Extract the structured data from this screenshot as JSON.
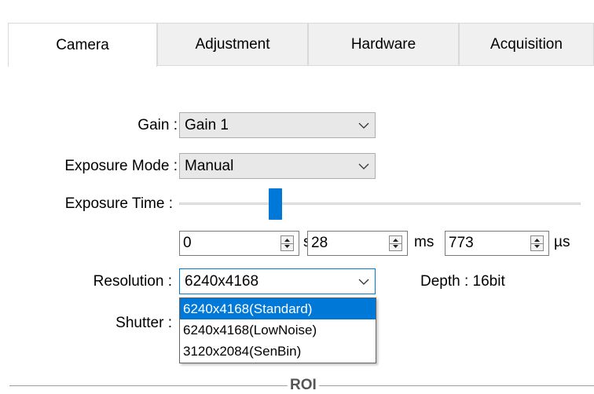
{
  "tabs": [
    {
      "label": "Camera",
      "active": true
    },
    {
      "label": "Adjustment",
      "active": false
    },
    {
      "label": "Hardware",
      "active": false
    },
    {
      "label": "Acquisition",
      "active": false
    }
  ],
  "gain": {
    "label": "Gain :",
    "value": "Gain 1"
  },
  "exposure_mode": {
    "label": "Exposure Mode :",
    "value": "Manual"
  },
  "exposure_time": {
    "label": "Exposure Time :",
    "slider_position": 0.23
  },
  "time_fields": [
    {
      "value": "0",
      "unit": "s"
    },
    {
      "value": "28",
      "unit": "ms"
    },
    {
      "value": "773",
      "unit": "µs"
    }
  ],
  "resolution": {
    "label": "Resolution :",
    "value": "6240x4168"
  },
  "depth": {
    "text": "Depth : 16bit"
  },
  "shutter": {
    "label": "Shutter :"
  },
  "resolution_options": [
    "6240x4168(Standard)",
    "6240x4168(LowNoise)",
    "3120x2084(SenBin)"
  ],
  "roi": {
    "label": "ROI"
  },
  "colors": {
    "accent": "#0078d7"
  }
}
